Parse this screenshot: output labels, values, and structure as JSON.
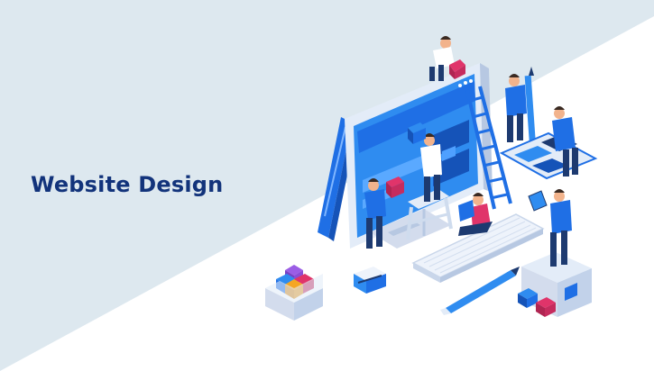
{
  "heading": {
    "text": "Website Design"
  },
  "colors": {
    "background_band": "#dde8ef",
    "background_white": "#ffffff",
    "heading": "#12337b",
    "primary_blue": "#1f6fe5",
    "screen_blue": "#2f8cf0",
    "dark_navy": "#1d3a70",
    "accent_pink": "#e0346a",
    "light_panel": "#e3ecf8"
  },
  "illustration": {
    "subject": "isometric-website-design-team",
    "objects": [
      "monitor",
      "ladder",
      "step-ladder",
      "keyboard",
      "pencil",
      "color-cube-box",
      "sharpener",
      "layout-board",
      "pedestal",
      "person-with-laptop",
      "person-with-tablet"
    ]
  }
}
